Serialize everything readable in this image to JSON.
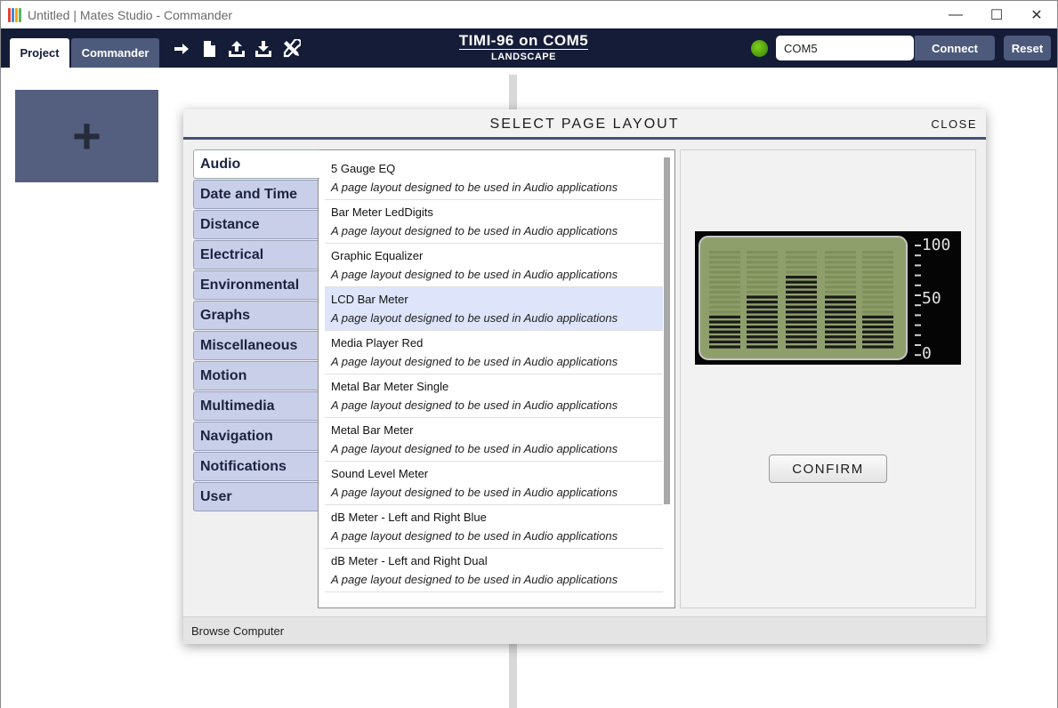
{
  "window": {
    "title": "Untitled | Mates Studio - Commander",
    "controls": [
      "—",
      "☐",
      "✕"
    ],
    "app_icon_colors": [
      "#e0413a",
      "#3d8bd6",
      "#f2a516",
      "#59b556"
    ]
  },
  "toolbar": {
    "tabs": [
      {
        "label": "Project",
        "active": true
      },
      {
        "label": "Commander",
        "active": false
      }
    ],
    "tools": [
      "arrow-right-icon",
      "new-file-icon",
      "upload-icon",
      "download-icon",
      "tools-icon"
    ],
    "device_name": "TIMI-96 on COM5",
    "orientation": "LANDSCAPE",
    "port_value": "COM5",
    "connect_label": "Connect",
    "reset_label": "Reset",
    "status_color": "#5aa812"
  },
  "workspace": {
    "add_page_symbol": "+"
  },
  "modal": {
    "title": "SELECT PAGE LAYOUT",
    "close_label": "CLOSE",
    "categories": [
      "Audio",
      "Date and Time",
      "Distance",
      "Electrical",
      "Environmental",
      "Graphs",
      "Miscellaneous",
      "Motion",
      "Multimedia",
      "Navigation",
      "Notifications",
      "User"
    ],
    "active_category": "Audio",
    "layouts": [
      {
        "name": "5 Gauge EQ",
        "description": "A page layout designed to be used in Audio applications"
      },
      {
        "name": "Bar Meter LedDigits",
        "description": "A page layout designed to be used in Audio applications"
      },
      {
        "name": "Graphic Equalizer",
        "description": "A page layout designed to be used in Audio applications"
      },
      {
        "name": "LCD Bar Meter",
        "description": "A page layout designed to be used in Audio applications",
        "selected": true
      },
      {
        "name": "Media Player Red",
        "description": "A page layout designed to be used in Audio applications"
      },
      {
        "name": "Metal Bar Meter Single",
        "description": "A page layout designed to be used in Audio applications"
      },
      {
        "name": "Metal Bar Meter",
        "description": "A page layout designed to be used in Audio applications"
      },
      {
        "name": "Sound Level Meter",
        "description": "A page layout designed to be used in Audio applications"
      },
      {
        "name": "dB Meter - Left and Right Blue",
        "description": "A page layout designed to be used in Audio applications"
      },
      {
        "name": "dB Meter - Left and Right Dual",
        "description": "A page layout designed to be used in Audio applications"
      }
    ],
    "preview": {
      "scale_labels": [
        "-100",
        "50",
        "0"
      ],
      "bar_levels": [
        0.35,
        0.55,
        0.75,
        0.55,
        0.35
      ]
    },
    "confirm_label": "CONFIRM",
    "browse_label": "Browse Computer"
  },
  "colors": {
    "toolbar_bg": "#141c38",
    "accent": "#4d5a7c",
    "tab_bg": "#c9cfe8",
    "selected_row": "#dee5fa"
  }
}
